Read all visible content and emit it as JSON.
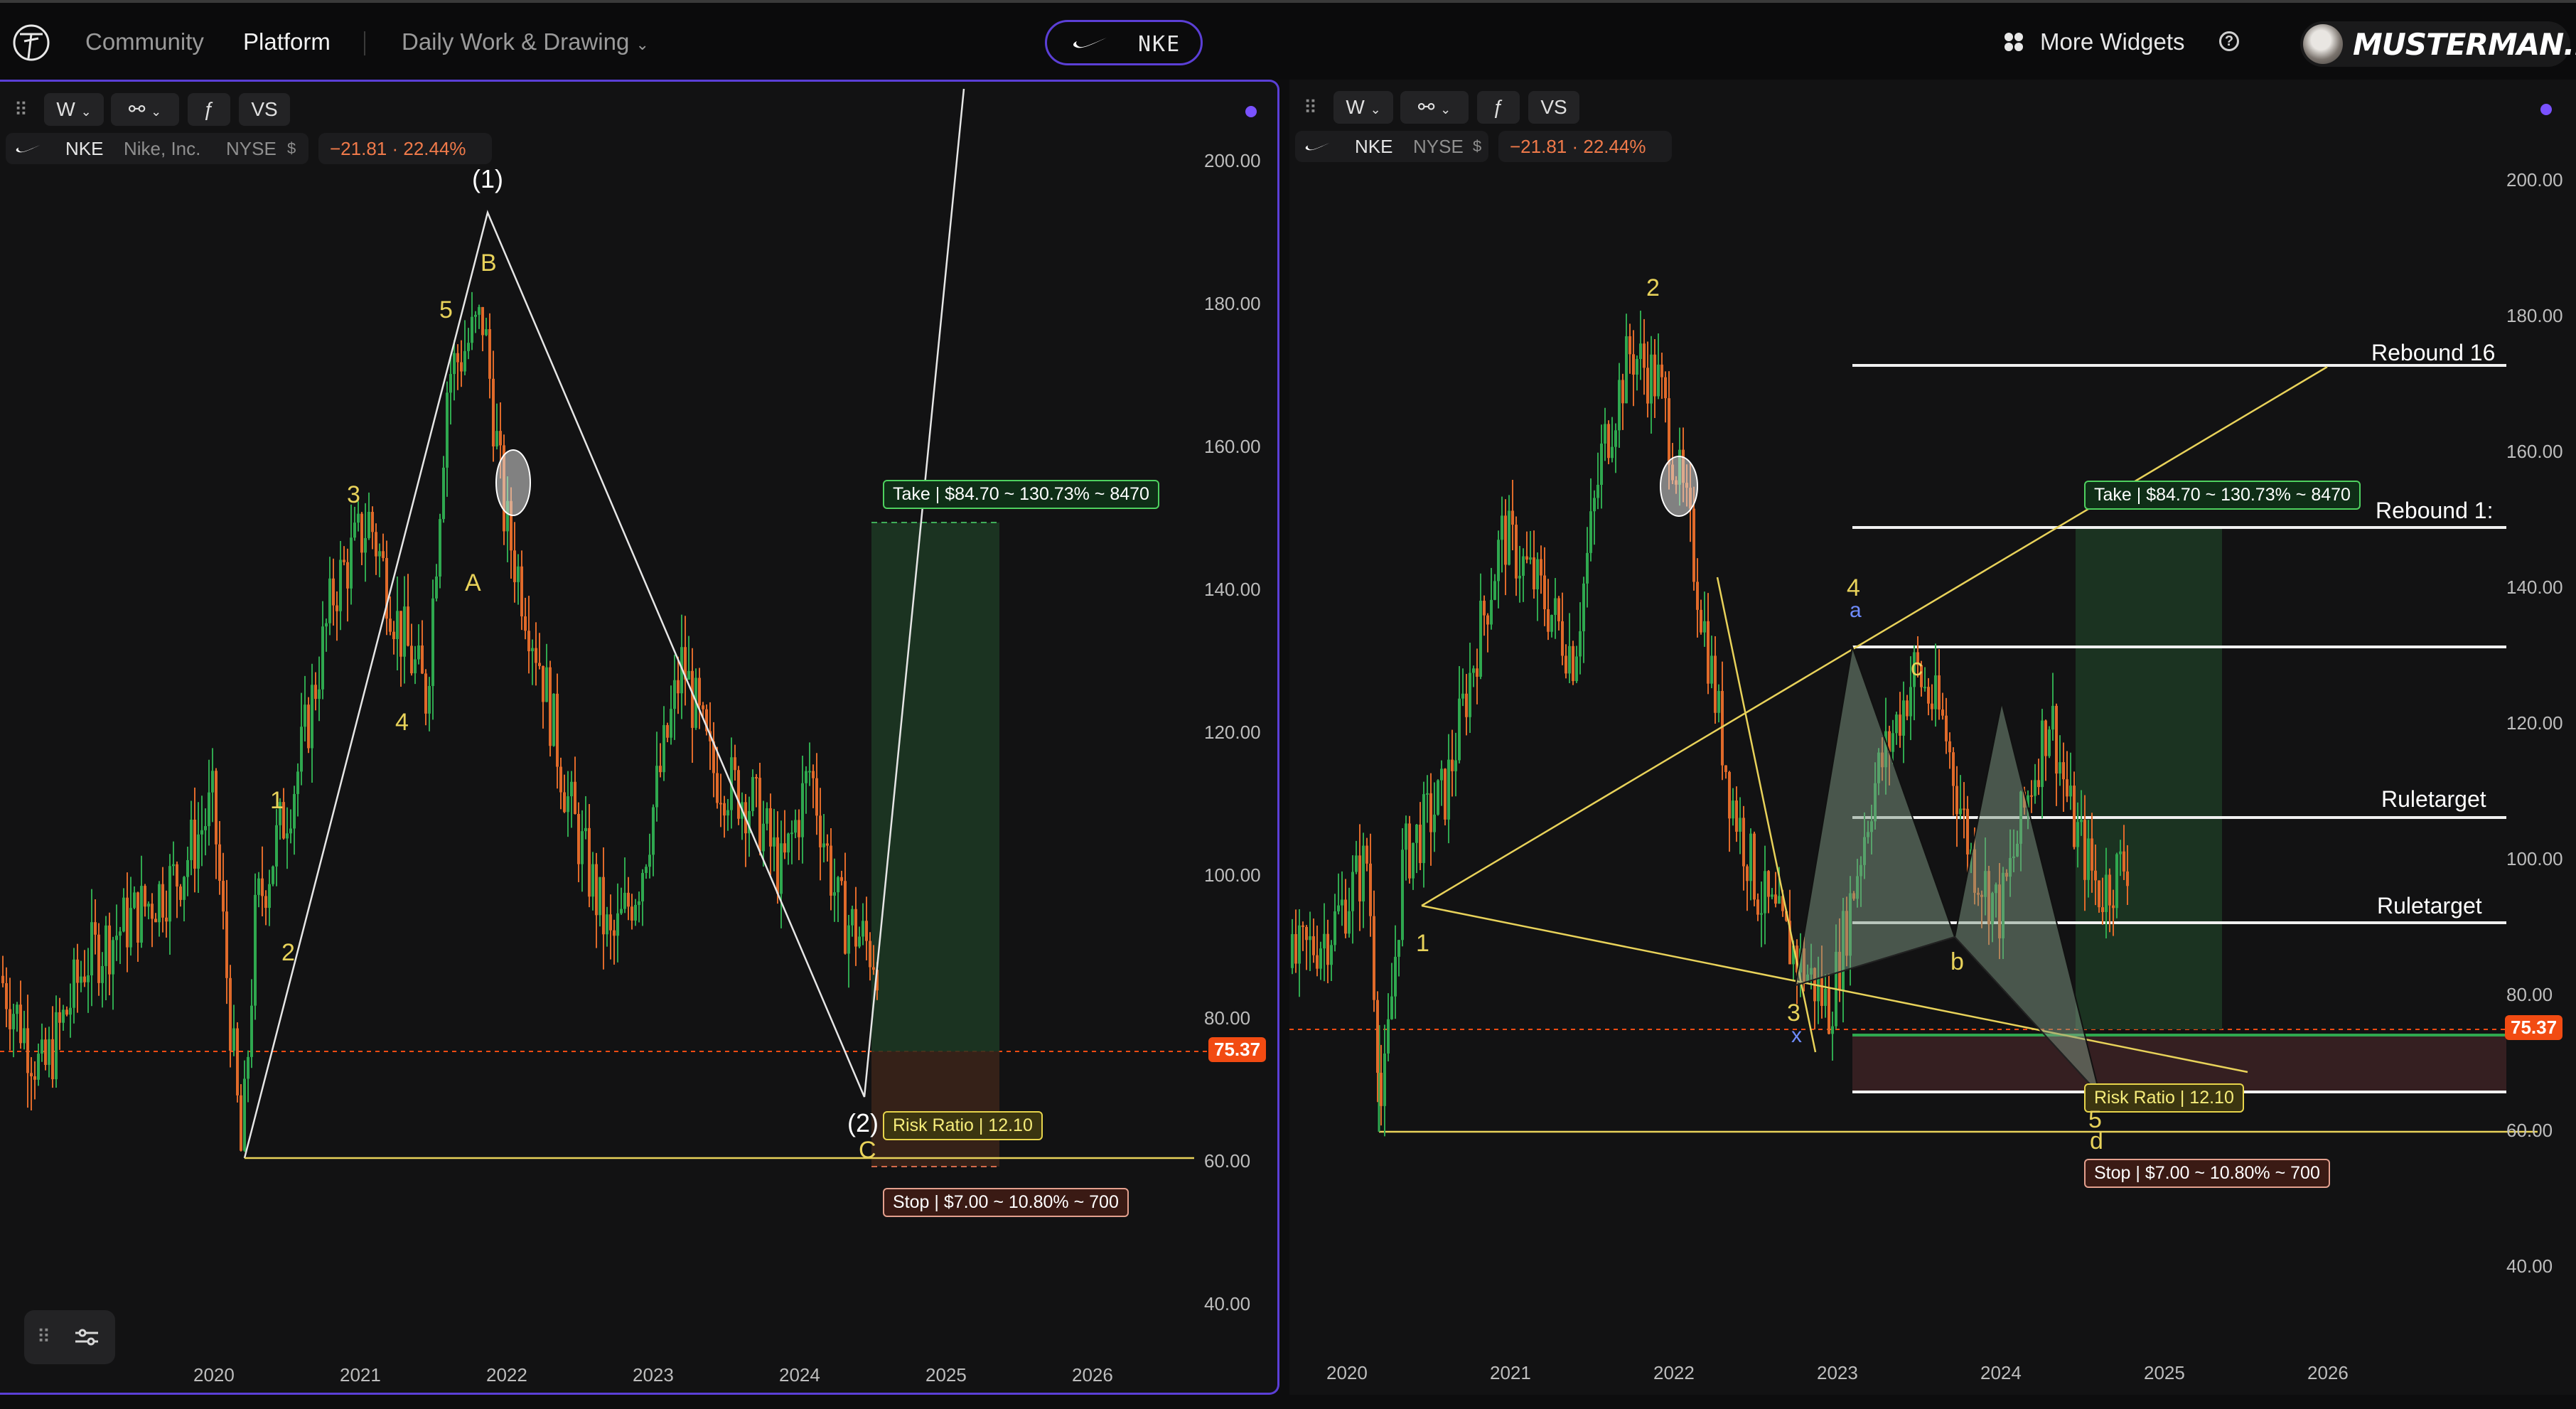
{
  "topbar": {
    "nav": {
      "community": "Community",
      "platform": "Platform",
      "layout": "Daily Work & Drawing"
    },
    "ticker": "NKE",
    "widgets": "More Widgets",
    "help": "?",
    "user": "MUSTERMAN..."
  },
  "left": {
    "toolbar": {
      "interval": "W",
      "compare": "VS"
    },
    "legend": {
      "symbol": "NKE",
      "name": "Nike, Inc.",
      "exchange": "NYSE",
      "change": "−21.81 · 22.44%"
    },
    "yaxis": [
      "200.00",
      "180.00",
      "160.00",
      "140.00",
      "120.00",
      "100.00",
      "80.00",
      "60.00",
      "40.00"
    ],
    "xaxis": [
      "2020",
      "2021",
      "2022",
      "2023",
      "2024",
      "2025",
      "2026"
    ],
    "price": "75.37",
    "take": "Take | $84.70 ~ 130.73% ~ 8470",
    "risk": "Risk Ratio | 12.10",
    "stop": "Stop | $7.00 ~ 10.80% ~ 700",
    "waves": {
      "w1": "(1)",
      "w2": "(2)",
      "B": "B",
      "A": "A",
      "C": "C",
      "n5": "5",
      "n3": "3",
      "n4": "4",
      "n1": "1",
      "n2": "2"
    }
  },
  "right": {
    "toolbar": {
      "interval": "W",
      "compare": "VS"
    },
    "legend": {
      "symbol": "NKE",
      "exchange": "NYSE",
      "change": "−21.81 · 22.44%"
    },
    "yaxis": [
      "200.00",
      "180.00",
      "160.00",
      "140.00",
      "120.00",
      "100.00",
      "80.00",
      "60.00",
      "40.00"
    ],
    "xaxis": [
      "2020",
      "2021",
      "2022",
      "2023",
      "2024",
      "2025",
      "2026"
    ],
    "price": "75.37",
    "take": "Take | $84.70 ~ 130.73% ~ 8470",
    "risk": "Risk Ratio | 12.10",
    "stop": "Stop | $7.00 ~ 10.80% ~ 700",
    "levels": {
      "rebound1": "Rebound 16",
      "rebound2": "Rebound 1:",
      "rule1": "Ruletarget",
      "rule2": "Ruletarget"
    },
    "waves": {
      "n2": "2",
      "n1": "1",
      "n4": "4",
      "n3": "3",
      "n5": "5",
      "a": "a",
      "b": "b",
      "c": "c",
      "d": "d",
      "x": "x"
    }
  },
  "colors": {
    "accent": "#5b3fd6",
    "up": "#2fa84f",
    "down": "#e06a2a",
    "wave": "#e8d25a",
    "price": "#f24b12"
  },
  "icons": [
    "nike-swoosh-icon",
    "grid-widgets-icon",
    "help-icon",
    "drag-handle-icon",
    "candles-icon",
    "indicator-icon"
  ]
}
